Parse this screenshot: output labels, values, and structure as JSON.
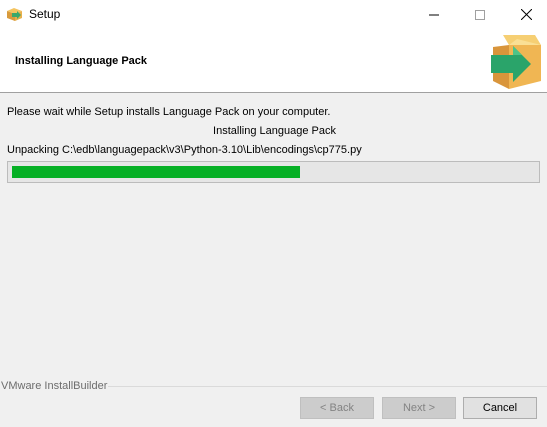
{
  "window": {
    "title": "Setup",
    "icon": "installer-box-icon",
    "controls": [
      "minimize-icon",
      "maximize-icon",
      "close-icon"
    ]
  },
  "header": {
    "title": "Installing Language Pack",
    "logo": "installer-box-arrow-icon"
  },
  "body": {
    "wait_message": "Please wait while Setup installs Language Pack on your computer.",
    "status_title": "Installing Language Pack",
    "unpacking_text": "Unpacking C:\\edb\\languagepack\\v3\\Python-3.10\\Lib\\encodings\\cp775.py"
  },
  "progress": {
    "percent": 55,
    "color": "#06b025"
  },
  "footer": {
    "brand": "VMware InstallBuilder",
    "back_label": "< Back",
    "next_label": "Next >",
    "cancel_label": "Cancel"
  }
}
